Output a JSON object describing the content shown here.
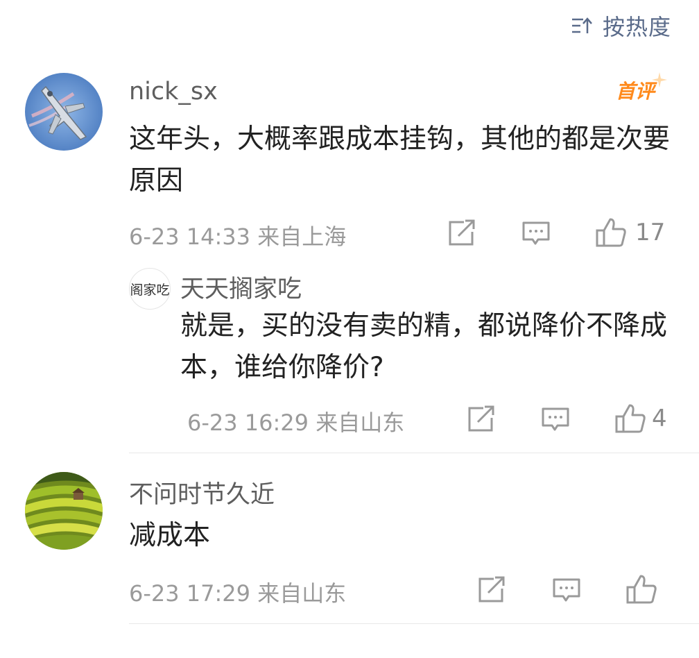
{
  "sort": {
    "label": "按热度",
    "icon": "sort-hot-icon"
  },
  "comments": [
    {
      "username": "nick_sx",
      "badge": "首评",
      "content": "这年头，大概率跟成本挂钩，其他的都是次要原因",
      "time": "6-23 14:33 来自上海",
      "likes": "17",
      "replies": [
        {
          "avatar_text": "阁家吃",
          "username": "天天搁家吃",
          "content": "就是，买的没有卖的精，都说降价不降成本，谁给你降价?",
          "time": "6-23 16:29 来自山东",
          "likes": "4"
        }
      ]
    },
    {
      "username": "不问时节久近",
      "content": "减成本",
      "time": "6-23 17:29 来自山东",
      "likes": ""
    }
  ],
  "colors": {
    "accent": "#5a6b8a",
    "badge": "#ff8a1c",
    "meta": "#9a9a9a"
  }
}
